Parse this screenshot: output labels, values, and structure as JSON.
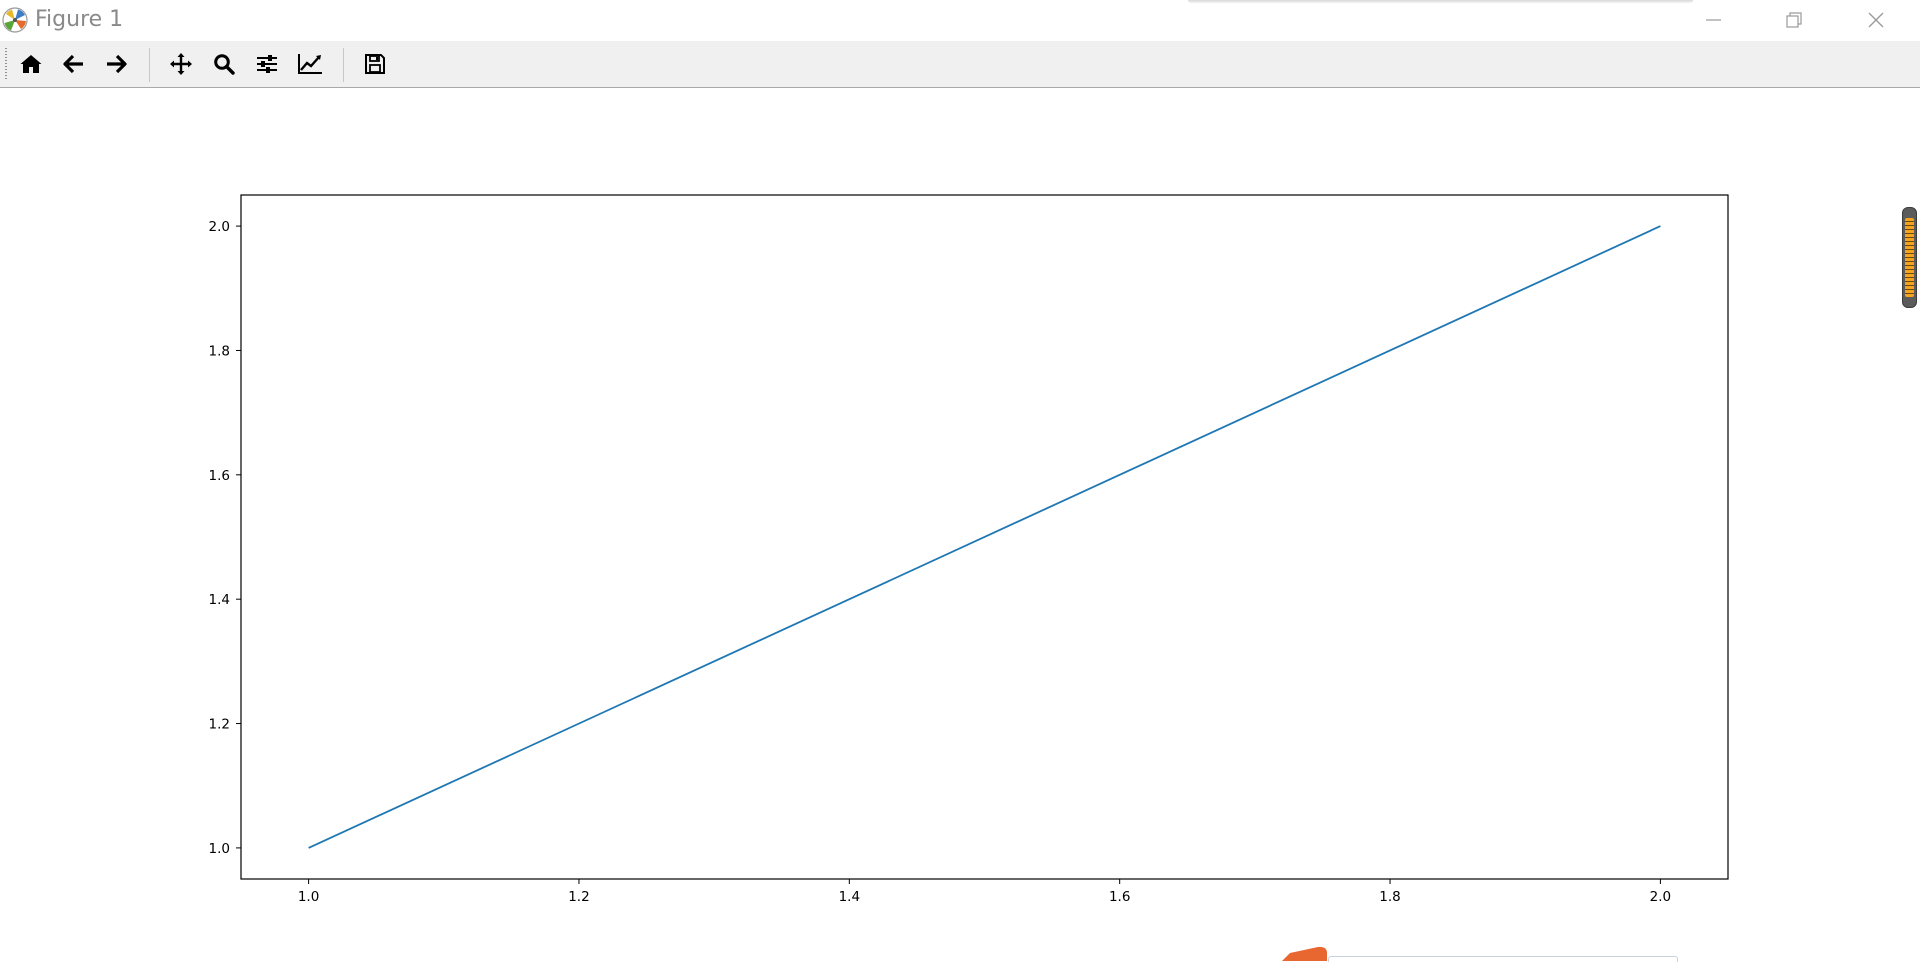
{
  "window": {
    "title": "Figure 1",
    "controls": [
      "minimize-icon",
      "restore-icon",
      "close-icon"
    ]
  },
  "toolbar": {
    "buttons": [
      {
        "name": "home-button",
        "icon": "home-icon"
      },
      {
        "name": "back-button",
        "icon": "arrow-left-icon"
      },
      {
        "name": "forward-button",
        "icon": "arrow-right-icon"
      },
      {
        "name": "pan-button",
        "icon": "move-icon"
      },
      {
        "name": "zoom-button",
        "icon": "magnifier-icon"
      },
      {
        "name": "subplots-button",
        "icon": "sliders-icon"
      },
      {
        "name": "edit-axis-button",
        "icon": "line-chart-icon"
      },
      {
        "name": "save-button",
        "icon": "floppy-disk-icon"
      }
    ]
  },
  "chart_data": {
    "type": "line",
    "title": "",
    "xlabel": "",
    "ylabel": "",
    "xlim": [
      0.95,
      2.05
    ],
    "ylim": [
      0.95,
      2.05
    ],
    "x_ticks": [
      "1.0",
      "1.2",
      "1.4",
      "1.6",
      "1.8",
      "2.0"
    ],
    "y_ticks": [
      "1.0",
      "1.2",
      "1.4",
      "1.6",
      "1.8",
      "2.0"
    ],
    "grid": false,
    "legend": "none",
    "series": [
      {
        "x": [
          1,
          2
        ],
        "values": [
          1,
          2
        ],
        "color": "#1f77b4"
      }
    ]
  }
}
